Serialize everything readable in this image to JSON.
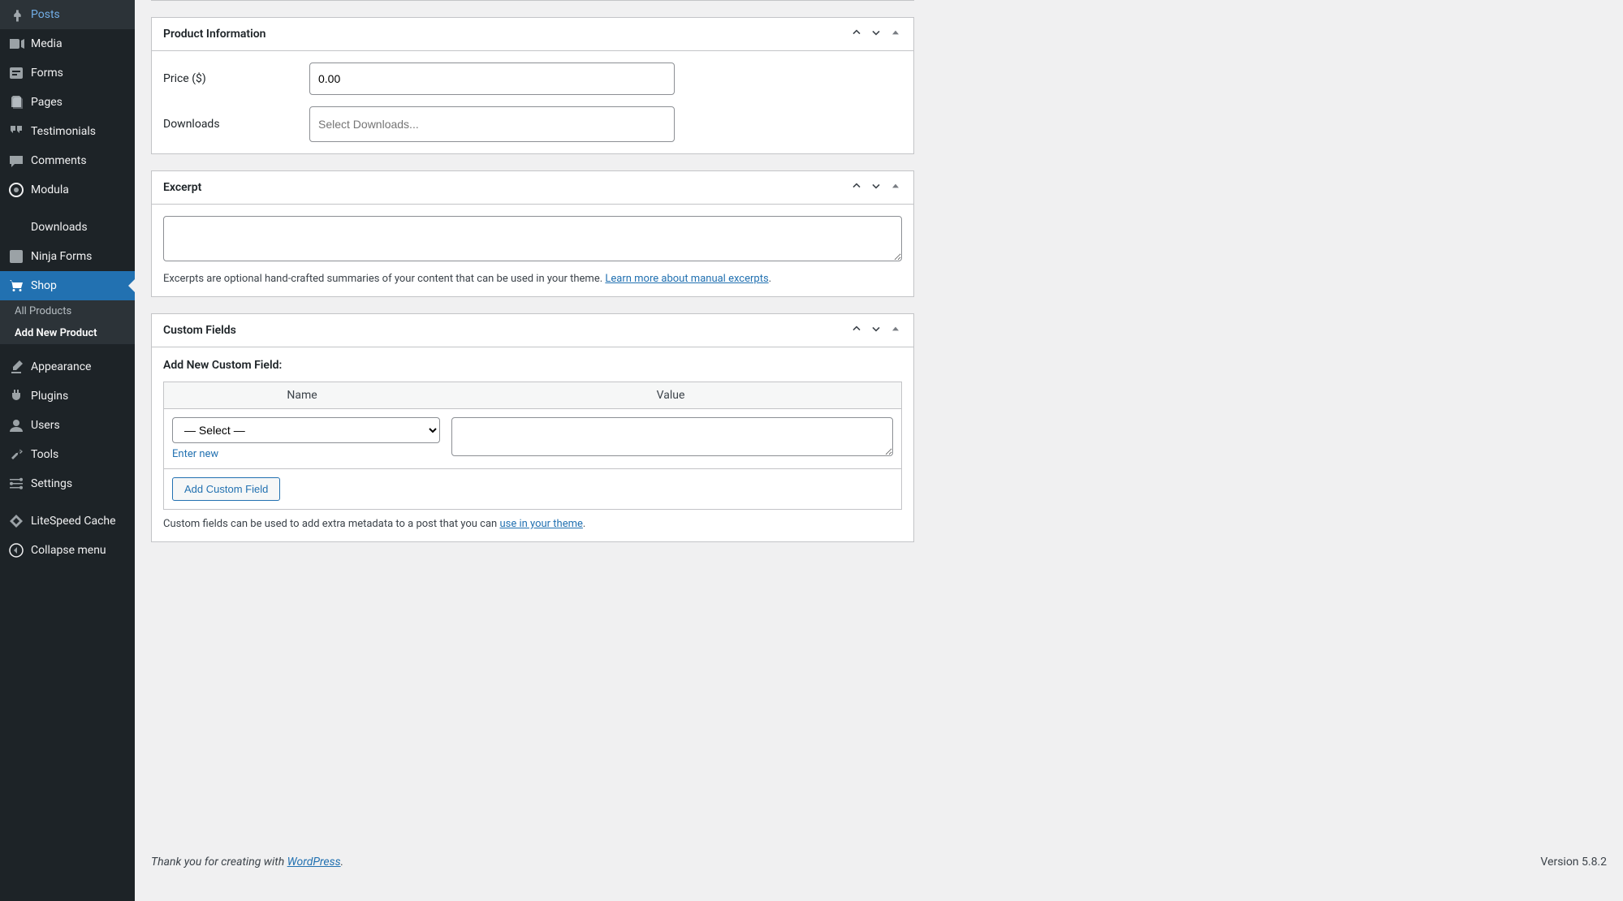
{
  "sidebar": {
    "items": [
      {
        "label": "Posts",
        "icon": "pin"
      },
      {
        "label": "Media",
        "icon": "media"
      },
      {
        "label": "Forms",
        "icon": "forms"
      },
      {
        "label": "Pages",
        "icon": "pages"
      },
      {
        "label": "Testimonials",
        "icon": "quote"
      },
      {
        "label": "Comments",
        "icon": "comments"
      },
      {
        "label": "Modula",
        "icon": "modula"
      }
    ],
    "items2": [
      {
        "label": "Downloads",
        "icon": "download"
      },
      {
        "label": "Ninja Forms",
        "icon": "ninja"
      },
      {
        "label": "Shop",
        "icon": "cart",
        "active": true
      }
    ],
    "submenu": [
      {
        "label": "All Products"
      },
      {
        "label": "Add New Product",
        "current": true
      }
    ],
    "items3": [
      {
        "label": "Appearance",
        "icon": "brush"
      },
      {
        "label": "Plugins",
        "icon": "plug"
      },
      {
        "label": "Users",
        "icon": "user"
      },
      {
        "label": "Tools",
        "icon": "wrench"
      },
      {
        "label": "Settings",
        "icon": "gear"
      }
    ],
    "items4": [
      {
        "label": "LiteSpeed Cache",
        "icon": "litespeed"
      },
      {
        "label": "Collapse menu",
        "icon": "collapse"
      }
    ]
  },
  "panels": {
    "product_info": {
      "title": "Product Information",
      "price_label": "Price ($)",
      "price_value": "0.00",
      "downloads_label": "Downloads",
      "downloads_placeholder": "Select Downloads..."
    },
    "excerpt": {
      "title": "Excerpt",
      "help_prefix": "Excerpts are optional hand-crafted summaries of your content that can be used in your theme. ",
      "help_link": "Learn more about manual excerpts",
      "help_suffix": "."
    },
    "custom_fields": {
      "title": "Custom Fields",
      "heading": "Add New Custom Field:",
      "col_name": "Name",
      "col_value": "Value",
      "select_placeholder": "— Select —",
      "enter_new": "Enter new",
      "add_button": "Add Custom Field",
      "help_prefix": "Custom fields can be used to add extra metadata to a post that you can ",
      "help_link": "use in your theme",
      "help_suffix": "."
    }
  },
  "footer": {
    "thanks_prefix": "Thank you for creating with ",
    "thanks_link": "WordPress",
    "thanks_suffix": ".",
    "version": "Version 5.8.2"
  }
}
